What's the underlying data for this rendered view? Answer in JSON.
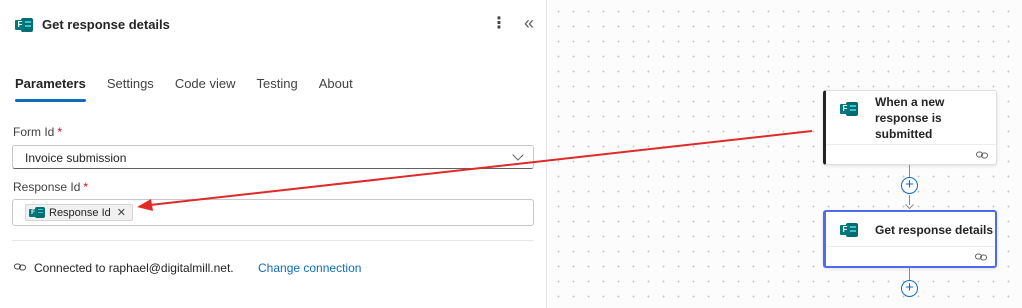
{
  "panel": {
    "title": "Get response details",
    "more_icon": "more-vertical-icon",
    "collapse_icon": "chevron-double-left-icon",
    "tabs": [
      {
        "label": "Parameters",
        "active": true
      },
      {
        "label": "Settings",
        "active": false
      },
      {
        "label": "Code view",
        "active": false
      },
      {
        "label": "Testing",
        "active": false
      },
      {
        "label": "About",
        "active": false
      }
    ],
    "form_id": {
      "label": "Form Id",
      "required": "*",
      "value": "Invoice submission"
    },
    "response_id": {
      "label": "Response Id",
      "required": "*",
      "token_label": "Response Id",
      "token_remove": "✕"
    },
    "connection": {
      "text": "Connected to raphael@digitalmill.net.",
      "change_label": "Change connection"
    }
  },
  "canvas": {
    "trigger_node": {
      "title": "When a new response is submitted"
    },
    "action_node": {
      "title": "Get response details"
    },
    "plus_label": "+"
  },
  "colors": {
    "accent": "#0f6cbd",
    "selected_node_border": "#4f6bed",
    "forms_brand": "#036c70",
    "annotation_arrow": "#e02a2a",
    "required": "#c50f1f"
  }
}
